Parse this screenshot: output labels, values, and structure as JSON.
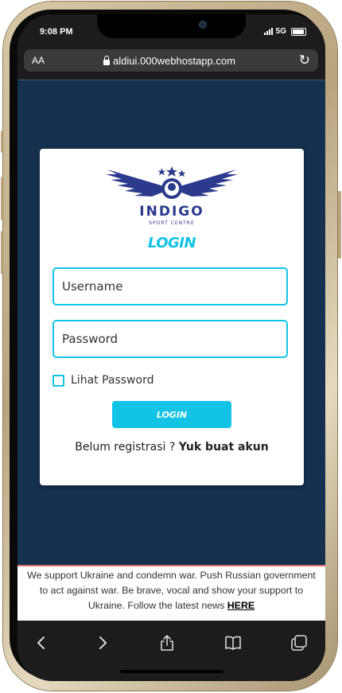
{
  "status_bar": {
    "time": "9:08 PM",
    "network": "5G"
  },
  "browser": {
    "text_size_label": "AA",
    "url": "aldiui.000webhostapp.com"
  },
  "login_card": {
    "logo_text": "INDIGO",
    "logo_subtext": "SPORT CENTRE",
    "title": "LOGIN",
    "username_placeholder": "Username",
    "password_placeholder": "Password",
    "show_password_label": "Lihat Password",
    "login_button_label": "LOGIN",
    "register_prompt": "Belum registrasi ? ",
    "register_link": "Yuk buat akun"
  },
  "banner": {
    "text": "We support Ukraine and condemn war. Push Russian government to act against war. Be brave, vocal and show your support to Ukraine. Follow the latest news ",
    "link_label": "HERE"
  },
  "colors": {
    "accent": "#12c3e6",
    "page_background": "#16314f",
    "bar_background": "#1c1c1e"
  }
}
